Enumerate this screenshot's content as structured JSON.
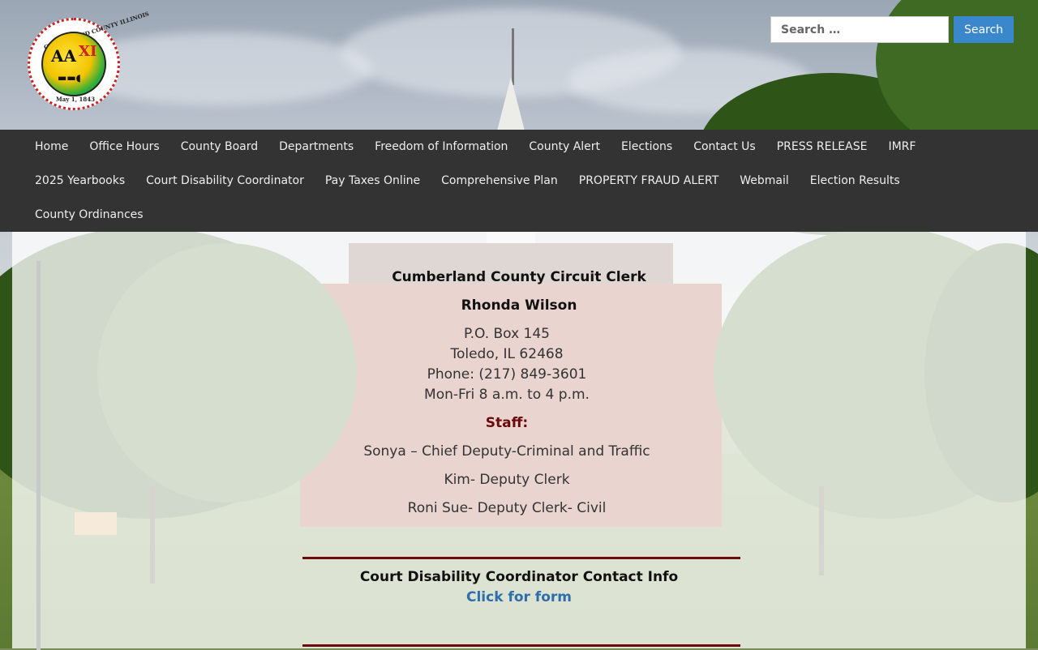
{
  "header": {
    "logo": {
      "ring_text": "CUMBERLAND COUNTY ILLINOIS",
      "date_text": "May 1, 1843"
    },
    "search": {
      "placeholder": "Search …",
      "button_label": "Search"
    }
  },
  "nav": {
    "row1": [
      "Home",
      "Office Hours",
      "County Board",
      "Departments",
      "Freedom of Information",
      "County Alert",
      "Elections",
      "Contact Us",
      "PRESS RELEASE",
      "IMRF"
    ],
    "row2": [
      "2025 Yearbooks",
      "Court Disability Coordinator",
      "Pay Taxes Online",
      "Comprehensive Plan",
      "PROPERTY FRAUD ALERT",
      "Webmail",
      "Election Results"
    ],
    "row3": [
      "County Ordinances"
    ]
  },
  "content": {
    "office_title": "Cumberland County Circuit Clerk",
    "clerk_name": "Rhonda Wilson",
    "address_line1": "P.O. Box 145",
    "address_line2": "Toledo, IL 62468",
    "phone": "Phone: (217) 849-3601",
    "hours": "Mon-Fri 8 a.m. to 4 p.m.",
    "staff_heading": "Staff:",
    "staff": [
      "Sonya – Chief Deputy-Criminal and Traffic",
      "Kim- Deputy Clerk",
      "Roni Sue- Deputy Clerk- Civil"
    ],
    "disability_heading": "Court Disability Coordinator Contact Info",
    "disability_link": "Click for form"
  },
  "colors": {
    "nav_bg": "#333333",
    "search_button": "#3a87cc",
    "staff_heading": "#6b0a0a",
    "link": "#2d6eab",
    "rule": "#6b0a0a"
  },
  "icons": [
    "county-seal-logo"
  ]
}
